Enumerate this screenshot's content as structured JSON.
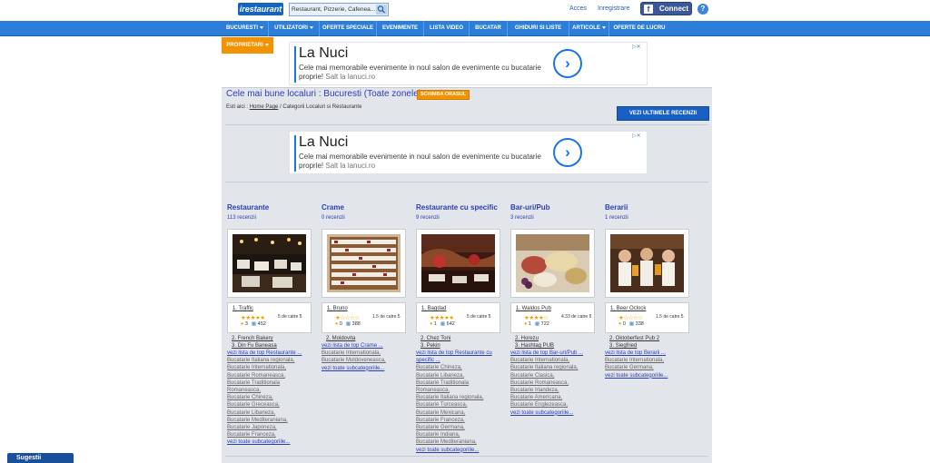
{
  "header": {
    "logo": "irestaurant",
    "search_placeholder": "Restaurant, Pizzerie, Cafenea...",
    "links": [
      "Acces",
      "Inregistrare"
    ],
    "connect_label": "Connect",
    "help": "?"
  },
  "nav": {
    "items": [
      {
        "label": "BUCURESTI",
        "caret": true
      },
      {
        "label": "UTILIZATORI",
        "caret": true
      },
      {
        "label": "OFERTE SPECIALE",
        "caret": false
      },
      {
        "label": "EVENIMENTE",
        "caret": false
      },
      {
        "label": "LISTA VIDEO",
        "caret": false
      },
      {
        "label": "BUCATAR",
        "caret": false
      },
      {
        "label": "GHIDURI SI LISTE",
        "caret": false
      },
      {
        "label": "ARTICOLE",
        "caret": true
      },
      {
        "label": "OFERTE DE LUCRU",
        "caret": false
      }
    ],
    "proprietari": "PROPRIETARI"
  },
  "ad": {
    "title": "La Nuci",
    "text": "Cele mai memorabile evenimente in noul salon de evenimente cu bucatarie proprie!",
    "source": "Salt la lanuci.ro",
    "arrow": "›"
  },
  "page": {
    "title": "Cele mai bune localuri : Bucuresti (Toate zonele)",
    "change_city": "SCHIMBA ORASUL",
    "crumbs_prefix": "Esti aici :",
    "crumbs_home": "Home Page",
    "crumbs_rest": "/ Categorii Localuri si Restaurante",
    "latest_reviews": "VEZI ULTIMELE RECENZII"
  },
  "categories": [
    {
      "title": "Restaurante",
      "reviews": "113 recenzii",
      "top1": "1. Traffic",
      "stars": "★★★★★",
      "rating": "5 de catre 5",
      "c1": "3",
      "c2": "452",
      "others": [
        "2. French Bakery",
        "3. Din Fu Baneasa"
      ],
      "top_link": "vezi lista de top Restaurante ...",
      "subs": [
        "Bucatarie Italiana regionala,",
        "Bucatarie Internationala,",
        "Bucatarie Romaneasca,",
        "Bucatarie Traditionala",
        "Romaneasca,",
        "Bucatarie Chineza,",
        "Bucatarie Greceasca,",
        "Bucatarie Libaneza,",
        "Bucatarie Mediteraniana,",
        "Bucatarie Japoneza,",
        "Bucatarie Franceza,"
      ],
      "all_link": "vezi toate subcategoriile..."
    },
    {
      "title": "Crame",
      "reviews": "0 recenzii",
      "top1": "1. Bruno",
      "stars": "★☆☆☆☆",
      "rating": "1.5 de catre 5",
      "c1": "0",
      "c2": "388",
      "others": [
        "2. Moldovita"
      ],
      "top_link": "vezi lista de top Crame ...",
      "subs": [
        "Bucatarie Internationala,",
        "Bucatarie Moldoveneasca,"
      ],
      "all_link": "vezi toate subcategoriile..."
    },
    {
      "title": "Restaurante cu specific",
      "reviews": "9 recenzii",
      "top1": "1. Bagdad",
      "stars": "★★★★★",
      "rating": "5 de catre 5",
      "c1": "1",
      "c2": "642",
      "others": [
        "2. Chez Toni",
        "3. Pekin"
      ],
      "top_link": "vezi lista de top Restaurante cu",
      "top_link2": "specific ...",
      "subs": [
        "Bucatarie Chineza,",
        "Bucatarie Libaneza,",
        "Bucatarie Traditionala",
        "Romaneasca,",
        "Bucatarie Italiana regionala,",
        "Bucatarie Turceasca,",
        "Bucatarie Mexicana,",
        "Bucatarie Franceza,",
        "Bucatarie Germana,",
        "Bucatarie Indiana,",
        "Bucatarie Mediteraniana,"
      ],
      "all_link": "vezi toate subcategoriile..."
    },
    {
      "title": "Bar-uri/Pub",
      "reviews": "3 recenzii",
      "top1": "1. Waldos Pub",
      "stars": "★★★★☆",
      "rating": "4.33 de catre 5",
      "c1": "1",
      "c2": "722",
      "others": [
        "2. Horezu",
        "3. Hashtag PUB"
      ],
      "top_link": "vezi lista de top Bar-uri/Pub ...",
      "subs": [
        "Bucatarie Internationala,",
        "Bucatarie Italiana regionala,",
        "Bucatarie Clasica,",
        "Bucatarie Romaneasca,",
        "Bucatarie Irlandeza,",
        "Bucatarie Americana,",
        "Bucatarie Englezeasca,"
      ],
      "all_link": "vezi toate subcategoriile..."
    },
    {
      "title": "Berarii",
      "reviews": "1 recenzii",
      "top1": "1. Beer Oclock",
      "stars": "★☆☆☆☆",
      "rating": "1.5 de catre 5",
      "c1": "0",
      "c2": "338",
      "others": [
        "2. Oktoberfest Pub 2",
        "3. Siegfried"
      ],
      "top_link": "vezi lista de top Berarii ...",
      "subs": [
        "Bucatarie Internationala,",
        "Bucatarie Germana,"
      ],
      "all_link": "vezi toate subcategoriile..."
    }
  ],
  "sugestii": "Sugestii",
  "colors": {
    "nav_blue": "#2d7ed8",
    "orange": "#f39200",
    "link_blue": "#2a3db8",
    "panel_gray": "#e2e5ea"
  }
}
